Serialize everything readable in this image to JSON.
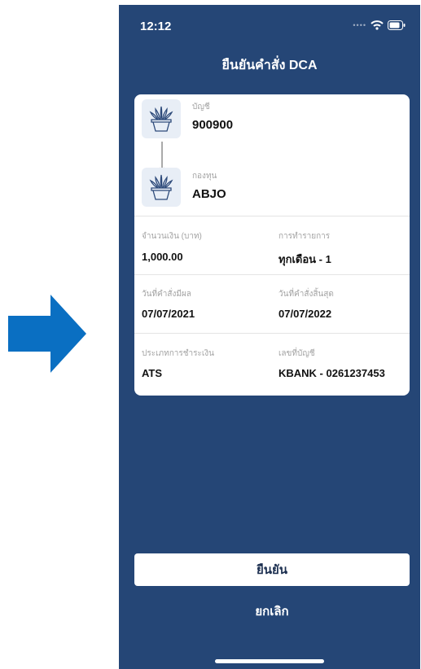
{
  "status_bar": {
    "time": "12:12"
  },
  "screen": {
    "title": "ยืนยันคำสั่ง DCA",
    "account": {
      "label": "บัญชี",
      "value": "900900"
    },
    "fund": {
      "label": "กองทุน",
      "value": "ABJO"
    },
    "fields": {
      "amount": {
        "label": "จำนวนเงิน (บาท)",
        "value": "1,000.00"
      },
      "frequency": {
        "label": "การทำรายการ",
        "value": "ทุกเดือน - 1"
      },
      "start_date": {
        "label": "วันที่คำสั่งมีผล",
        "value": "07/07/2021"
      },
      "end_date": {
        "label": "วันที่คำสั่งสิ้นสุด",
        "value": "07/07/2022"
      },
      "payment_type": {
        "label": "ประเภทการชำระเงิน",
        "value": "ATS"
      },
      "bank_account": {
        "label": "เลขที่บัญชี",
        "value": "KBANK - 0261237453"
      }
    },
    "confirm_label": "ยืนยัน",
    "cancel_label": "ยกเลิก"
  },
  "colors": {
    "arrow": "#0a6fc2",
    "background": "#254676",
    "card": "#ffffff"
  },
  "icons": [
    "right-arrow-icon",
    "wifi-icon",
    "battery-icon",
    "plant-pot-icon",
    "down-arrow-icon"
  ]
}
